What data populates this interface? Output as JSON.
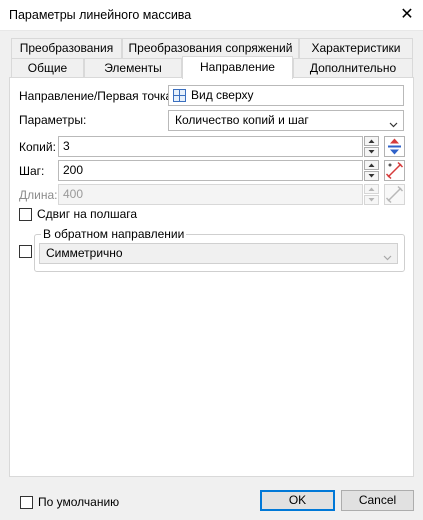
{
  "window": {
    "title": "Параметры линейного массива",
    "close_glyph": "✕"
  },
  "tabs_back": [
    "Преобразования",
    "Преобразования сопряжений",
    "Характеристики"
  ],
  "tabs_front": [
    "Общие",
    "Элементы",
    "Направление",
    "Дополнительно"
  ],
  "active_tab": "Направление",
  "direction": {
    "label": "Направление/Первая точка:",
    "value": "Вид сверху",
    "icon": "view-grid-icon"
  },
  "parameters": {
    "label": "Параметры:",
    "value": "Количество копий и шаг"
  },
  "copies": {
    "label": "Копий:",
    "value": "3"
  },
  "step": {
    "label": "Шаг:",
    "value": "200"
  },
  "length": {
    "label": "Длина:",
    "value": "400"
  },
  "half_step": {
    "label": "Сдвиг на полшага",
    "checked": false
  },
  "reverse": {
    "title": "В обратном направлении",
    "checked": false,
    "value": "Симметрично"
  },
  "footer": {
    "default_label": "По умолчанию",
    "ok_label": "OK",
    "cancel_label": "Cancel"
  },
  "colors": {
    "accent": "#0078d7",
    "red": "#d63b3b",
    "blue": "#2f62c9"
  }
}
